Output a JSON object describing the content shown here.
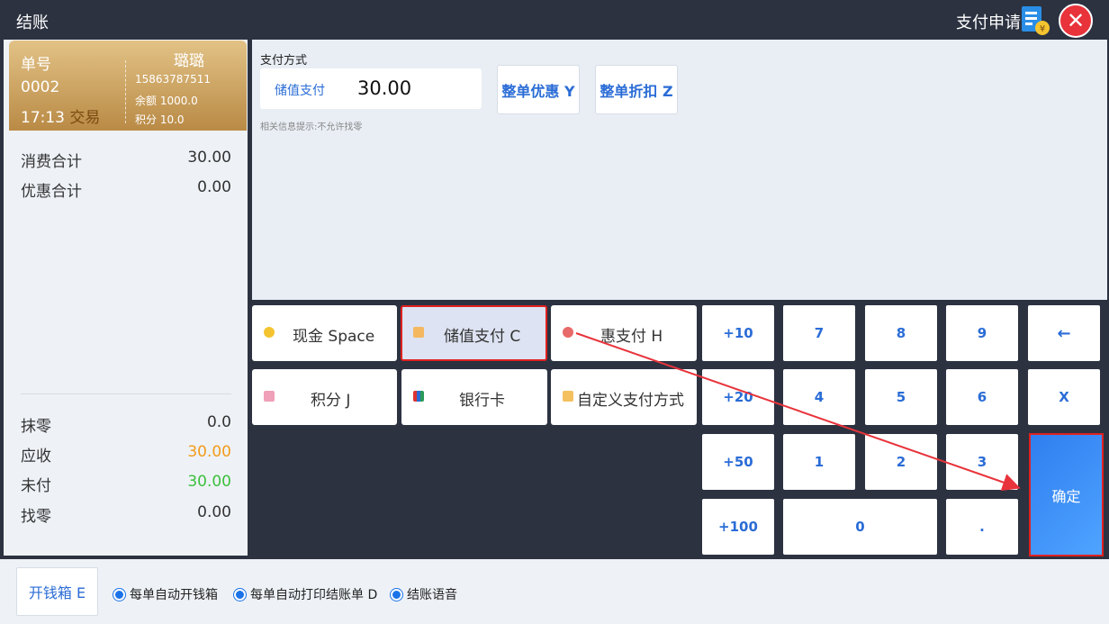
{
  "header": {
    "title": "结账",
    "pay_apply": "支付申请"
  },
  "order": {
    "no_label": "单号",
    "no": "0002",
    "time": "17:13",
    "trade": "交易",
    "member_name": "璐璐",
    "phone": "15863787511",
    "balance": "余额  1000.0",
    "points": "积分  10.0"
  },
  "summary": {
    "consume_label": "消费合计",
    "consume": "30.00",
    "discount_label": "优惠合计",
    "discount": "0.00",
    "rounding_label": "抹零",
    "rounding": "0.0",
    "receivable_label": "应收",
    "receivable": "30.00",
    "unpaid_label": "未付",
    "unpaid": "30.00",
    "change_label": "找零",
    "change": "0.00"
  },
  "payment_method": {
    "title": "支付方式",
    "current_name": "储值支付",
    "current_amount": "30.00",
    "order_discount": "整单优惠 Y",
    "order_rebate": "整单折扣 Z",
    "hint": "相关信息提示:不允许找零"
  },
  "pay_methods": [
    {
      "label": "现金 Space"
    },
    {
      "label": "储值支付 C"
    },
    {
      "label": "惠支付 H"
    },
    {
      "label": "积分 J"
    },
    {
      "label": "银行卡"
    },
    {
      "label": "自定义支付方式"
    }
  ],
  "keys": {
    "k_plus10": "+10",
    "k7": "7",
    "k8": "8",
    "k9": "9",
    "k_back": "←",
    "k_plus20": "+20",
    "k4": "4",
    "k5": "5",
    "k6": "6",
    "k_clear": "X",
    "k_plus50": "+50",
    "k1": "1",
    "k2": "2",
    "k3": "3",
    "k_plus100": "+100",
    "k0": "0",
    "k_dot": ".",
    "confirm": "确定"
  },
  "bottom": {
    "cash_drawer": "开钱箱 E",
    "opt_auto_drawer": "每单自动开钱箱",
    "opt_auto_print": "每单自动打印结账单 D",
    "opt_voice": "结账语音"
  },
  "colors": {
    "accent": "#2a6cd6",
    "orange": "#f29b1b",
    "green": "#3cbf3c",
    "close": "#e8333b",
    "highlight": "#e02020"
  }
}
